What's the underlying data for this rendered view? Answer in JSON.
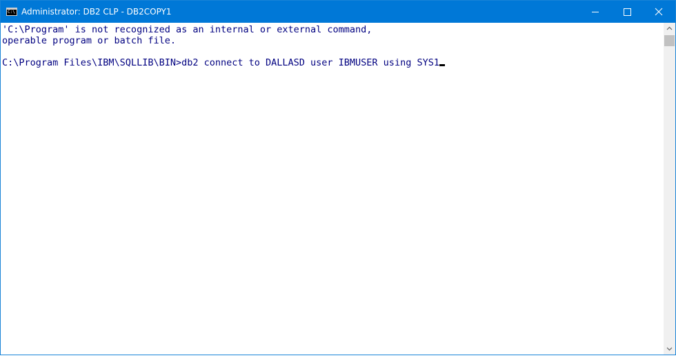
{
  "window": {
    "title": "Administrator: DB2 CLP - DB2COPY1",
    "app_icon_glyph": "C:\\",
    "accent_color": "#0078d7"
  },
  "controls": {
    "minimize_icon": "minimize-icon",
    "maximize_icon": "maximize-icon",
    "close_icon": "close-icon"
  },
  "console": {
    "text_color": "#000080",
    "background": "#ffffff",
    "lines": [
      "'C:\\Program' is not recognized as an internal or external command,",
      "operable program or batch file.",
      "",
      "C:\\Program Files\\IBM\\SQLLIB\\BIN>db2 connect to DALLASD user IBMUSER using SYS1"
    ]
  }
}
